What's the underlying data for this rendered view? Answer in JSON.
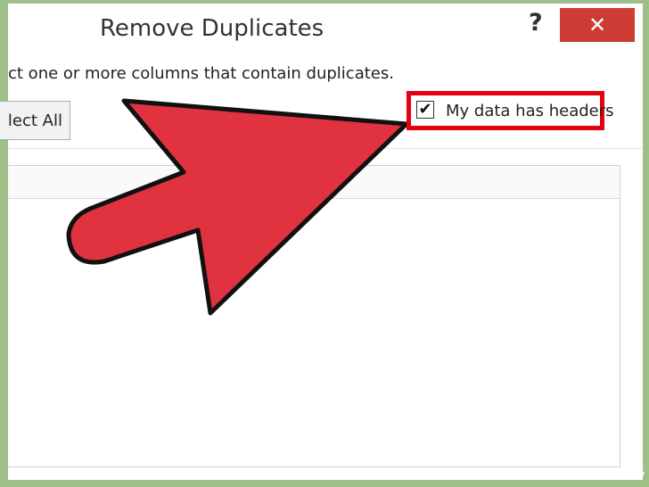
{
  "dialog": {
    "title": "Remove Duplicates",
    "help_glyph": "?",
    "close_glyph": "✕",
    "instruction": "ct one or more columns that contain duplicates.",
    "select_all_label": "lect All",
    "headers_checkbox": {
      "label": "My data has headers",
      "checked": true,
      "check_glyph": "✔"
    }
  },
  "annotation": {
    "arrow_color": "#e0323f",
    "highlight_color": "#e50010"
  },
  "watermark": "wikiHow"
}
